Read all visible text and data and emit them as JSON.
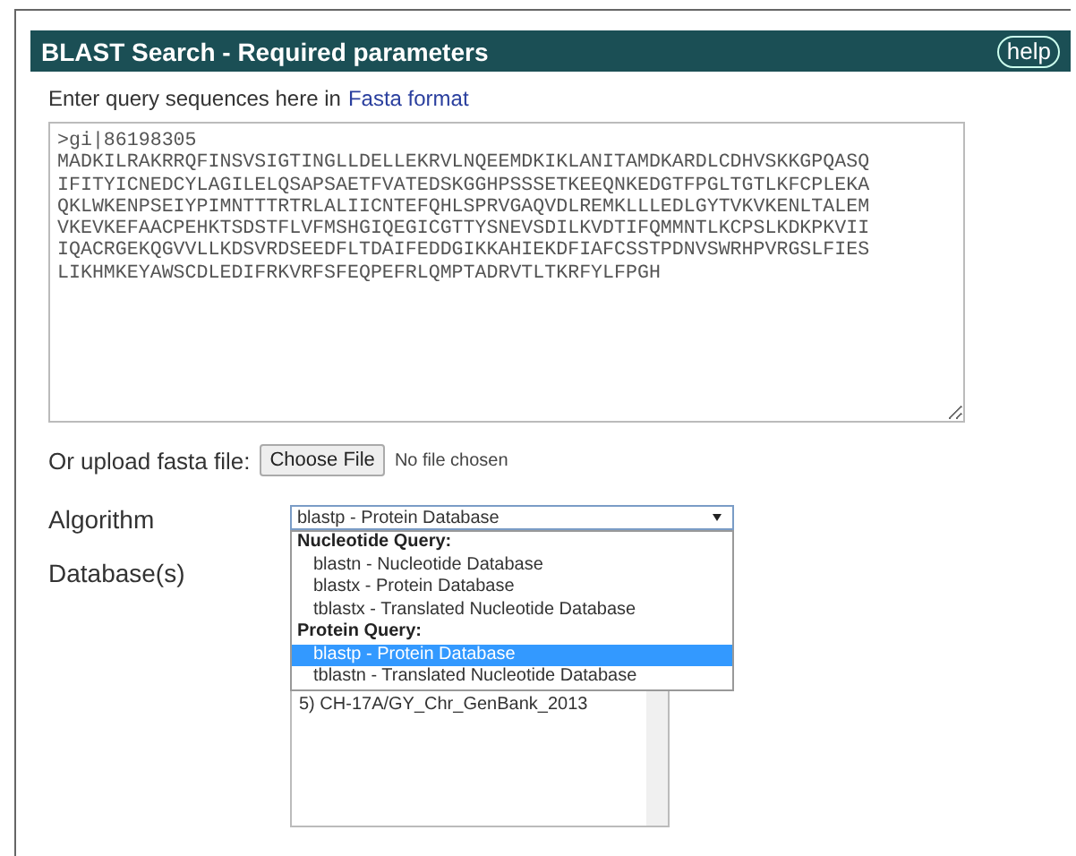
{
  "header": {
    "title": "BLAST Search - Required parameters",
    "help_button": "help"
  },
  "query": {
    "label": "Enter query sequences here in",
    "link": "Fasta format",
    "value": ">gi|86198305\nMADKILRAKRRQFINSVSIGTINGLLDELLEKRVLNQEEMDKIKLANITAMDKARDLCDHVSKKGPQASQ\nIFITYICNEDCYLAGILELQSAPSAETFVATEDSKGGHPSSSETKEEQNKEDGTFPGLTGTLKFCPLEKA\nQKLWKENPSEIYPIMNTTTRTRLALIICNTEFQHLSPRVGAQVDLREMKLLLEDLGYTVKVKENLTALEM\nVKEVKEFAACPEHKTSDSTFLVFMSHGIQEGICGTTYSNEVSDILKVDTIFQMMNTLKCPSLKDKPKVII\nIQACRGEKQGVVLLKDSVRDSEEDFLTDAIFEDDGIKKAHIEKDFIAFCSSTPDNVSWRHPVRGSLFIES\nLIKHMKEYAWSCDLEDIFRKVRFSFEQPEFRLQMPTADRVTLTKRFYLFPGH"
  },
  "upload": {
    "label": "Or upload fasta file:",
    "button": "Choose File",
    "status": "No file chosen"
  },
  "algorithm": {
    "label": "Algorithm",
    "value": "blastp - Protein Database",
    "expanded": true,
    "groups": [
      {
        "label": "Nucleotide Query:",
        "options": [
          {
            "label": "blastn - Nucleotide Database",
            "selected": false
          },
          {
            "label": "blastx - Protein Database",
            "selected": false
          },
          {
            "label": "tblastx - Translated Nucleotide Database",
            "selected": false
          }
        ]
      },
      {
        "label": "Protein Query:",
        "options": [
          {
            "label": "blastp - Protein Database",
            "selected": true
          },
          {
            "label": "tblastn - Translated Nucleotide Database",
            "selected": false
          }
        ]
      }
    ]
  },
  "database": {
    "label": "Database(s)",
    "items": [
      "5) CH-17A/GY_Chr_GenBank_2013"
    ]
  }
}
